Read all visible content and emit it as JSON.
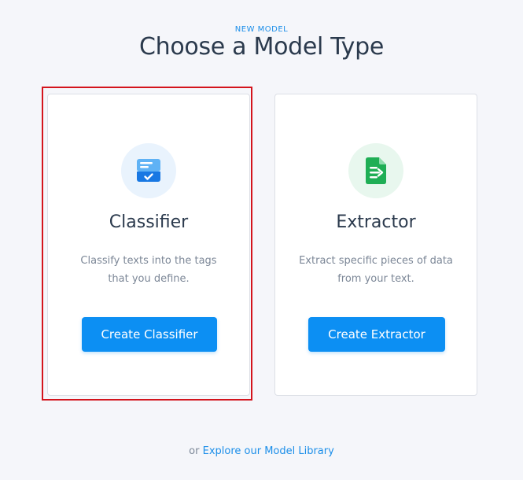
{
  "header": {
    "eyebrow": "NEW MODEL",
    "title": "Choose a Model Type"
  },
  "cards": [
    {
      "icon": "classifier-tray-check-icon",
      "title": "Classifier",
      "description": "Classify texts into the tags that you define.",
      "button_label": "Create Classifier",
      "accent_color": "#1b8ee9",
      "icon_bg_color": "#e9f3fd",
      "highlighted": true
    },
    {
      "icon": "extractor-document-arrow-icon",
      "title": "Extractor",
      "description": "Extract specific pieces of data from your text.",
      "button_label": "Create Extractor",
      "accent_color": "#21b35c",
      "icon_bg_color": "#e8f7ee",
      "highlighted": false
    }
  ],
  "footer": {
    "prefix": "or",
    "link_label": "Explore our Model Library"
  },
  "colors": {
    "background": "#f5f6fa",
    "primary_button": "#0c8ff3",
    "link": "#1b8ee9",
    "highlight_frame": "#d4141c"
  }
}
